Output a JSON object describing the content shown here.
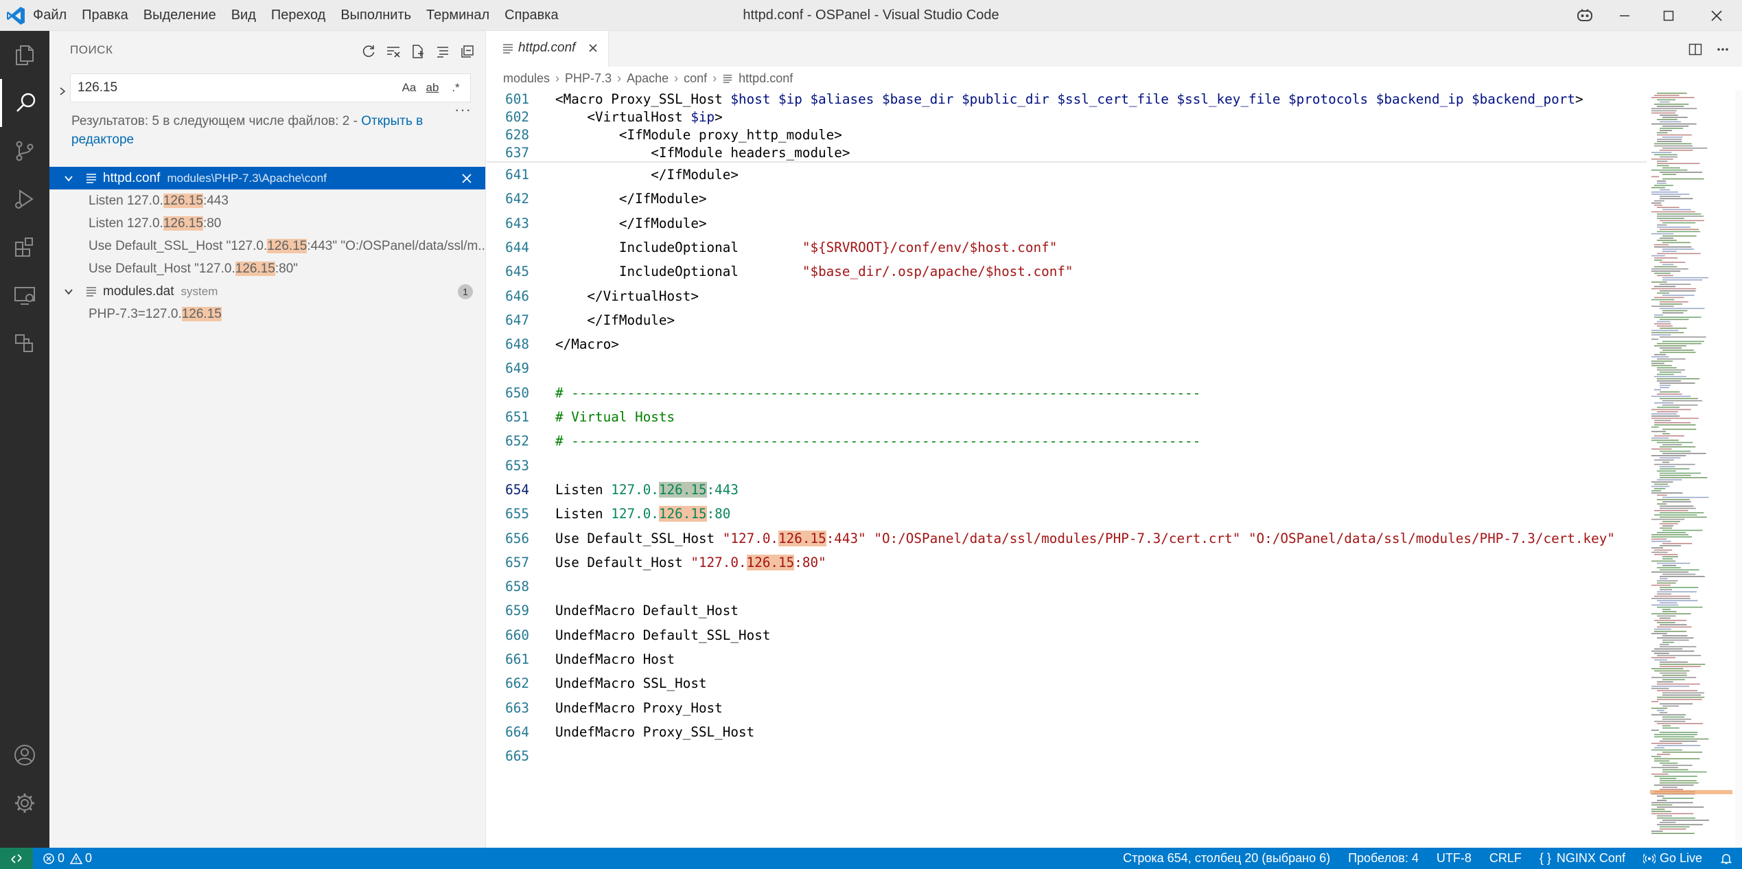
{
  "window": {
    "title": "httpd.conf - OSPanel - Visual Studio Code",
    "menu": [
      "Файл",
      "Правка",
      "Выделение",
      "Вид",
      "Переход",
      "Выполнить",
      "Терминал",
      "Справка"
    ]
  },
  "activity_bar": [
    "explorer-icon",
    "search-icon",
    "source-control-icon",
    "run-debug-icon",
    "extensions-icon",
    "remote-explorer-icon",
    "ports-icon",
    "account-icon",
    "manage-gear-icon"
  ],
  "sidebar": {
    "title": "ПОИСК",
    "search": {
      "value": "126.15",
      "options": [
        "Aa",
        "ab",
        ".*"
      ]
    },
    "summary_text": "Результатов: 5 в следующем числе файлов: 2 - ",
    "summary_link": "Открыть в редакторе",
    "files": [
      {
        "name": "httpd.conf",
        "path": "modules\\PHP-7.3\\Apache\\conf",
        "matches": [
          {
            "before": "Listen 127.0.",
            "match": "126.15",
            "after": ":443"
          },
          {
            "before": "Listen 127.0.",
            "match": "126.15",
            "after": ":80"
          },
          {
            "before": "Use Default_SSL_Host \"127.0.",
            "match": "126.15",
            "after": ":443\" \"O:/OSPanel/data/ssl/m..."
          },
          {
            "before": "Use Default_Host \"127.0.",
            "match": "126.15",
            "after": ":80\""
          }
        ]
      },
      {
        "name": "modules.dat",
        "path": "system",
        "badge": "1",
        "matches": [
          {
            "before": "PHP-7.3=127.0.",
            "match": "126.15",
            "after": ""
          }
        ]
      }
    ]
  },
  "editor": {
    "tab_label": "httpd.conf",
    "breadcrumb": [
      "modules",
      "PHP-7.3",
      "Apache",
      "conf",
      "httpd.conf"
    ],
    "sticky": [
      {
        "n": "601",
        "t": "<Macro Proxy_SSL_Host $host $ip $aliases $base_dir $public_dir $ssl_cert_file $ssl_key_file $protocols $backend_ip $backend_port>"
      },
      {
        "n": "602",
        "t": "    <VirtualHost $ip>"
      },
      {
        "n": "628",
        "t": "        <IfModule proxy_http_module>"
      },
      {
        "n": "637",
        "t": "            <IfModule headers_module>"
      }
    ],
    "lines": [
      {
        "n": "641",
        "t": "            </IfModule>"
      },
      {
        "n": "642",
        "t": "        </IfModule>"
      },
      {
        "n": "643",
        "t": "        </IfModule>"
      },
      {
        "n": "644",
        "t": "        IncludeOptional        \"${SRVROOT}/conf/env/$host.conf\""
      },
      {
        "n": "645",
        "t": "        IncludeOptional        \"$base_dir/.osp/apache/$host.conf\""
      },
      {
        "n": "646",
        "t": "    </VirtualHost>"
      },
      {
        "n": "647",
        "t": "    </IfModule>"
      },
      {
        "n": "648",
        "t": "</Macro>"
      },
      {
        "n": "649",
        "t": ""
      },
      {
        "n": "650",
        "t": "# -------------------------------------------------------------------------------"
      },
      {
        "n": "651",
        "t": "# Virtual Hosts"
      },
      {
        "n": "652",
        "t": "# -------------------------------------------------------------------------------"
      },
      {
        "n": "653",
        "t": ""
      },
      {
        "n": "654",
        "t": "Listen 127.0.126.15:443"
      },
      {
        "n": "655",
        "t": "Listen 127.0.126.15:80"
      },
      {
        "n": "656",
        "t": "Use Default_SSL_Host \"127.0.126.15:443\" \"O:/OSPanel/data/ssl/modules/PHP-7.3/cert.crt\" \"O:/OSPanel/data/ssl/modules/PHP-7.3/cert.key\""
      },
      {
        "n": "657",
        "t": "Use Default_Host \"127.0.126.15:80\""
      },
      {
        "n": "658",
        "t": ""
      },
      {
        "n": "659",
        "t": "UndefMacro Default_Host"
      },
      {
        "n": "660",
        "t": "UndefMacro Default_SSL_Host"
      },
      {
        "n": "661",
        "t": "UndefMacro Host"
      },
      {
        "n": "662",
        "t": "UndefMacro SSL_Host"
      },
      {
        "n": "663",
        "t": "UndefMacro Proxy_Host"
      },
      {
        "n": "664",
        "t": "UndefMacro Proxy_SSL_Host"
      },
      {
        "n": "665",
        "t": ""
      }
    ],
    "current_line": "654"
  },
  "statusbar": {
    "problems_errors": "0",
    "problems_warnings": "0",
    "position": "Строка 654, столбец 20 (выбрано 6)",
    "indent": "Пробелов: 4",
    "encoding": "UTF-8",
    "eol": "CRLF",
    "language": "NGINX Conf",
    "golive": "Go Live",
    "colors": {
      "statusbar": "#007acc",
      "remote": "#16825d",
      "selection": "#0060c0",
      "match": "#f4c6a5"
    }
  }
}
